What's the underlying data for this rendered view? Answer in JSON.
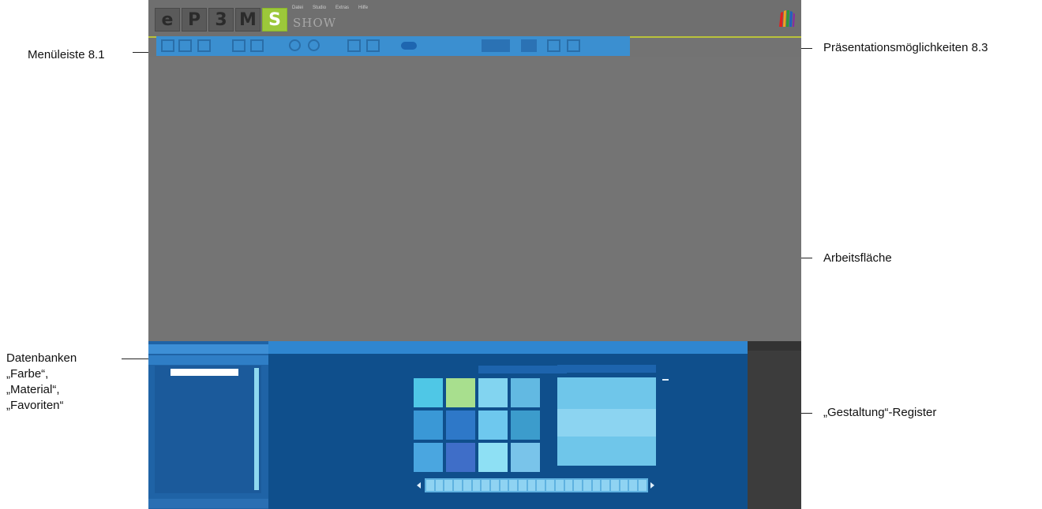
{
  "annotations": {
    "menu_bar": "Menüleiste 8.1",
    "presentation_options": "Präsentationsmöglichkeiten 8.3",
    "workspace": "Arbeitsfläche",
    "databases_line1": "Datenbanken",
    "databases_line2": "„Farbe“,",
    "databases_line3": "„Material“,",
    "databases_line4": "„Favoriten“",
    "design_tab": "„Gestaltung“-Register"
  },
  "app": {
    "logo_letters": [
      "e",
      "P",
      "3",
      "M",
      "S"
    ],
    "product_name": "SHOW",
    "menu_items": [
      "Datei",
      "Studio",
      "Extras",
      "Hilfe"
    ],
    "brand_logo": "caparol-logo-icon"
  },
  "colors": {
    "toolbar_blue": "#3b8fd0",
    "panel_blue": "#0f4f8c",
    "accent_green": "#9cc83a",
    "workspace_gray": "#747474"
  }
}
